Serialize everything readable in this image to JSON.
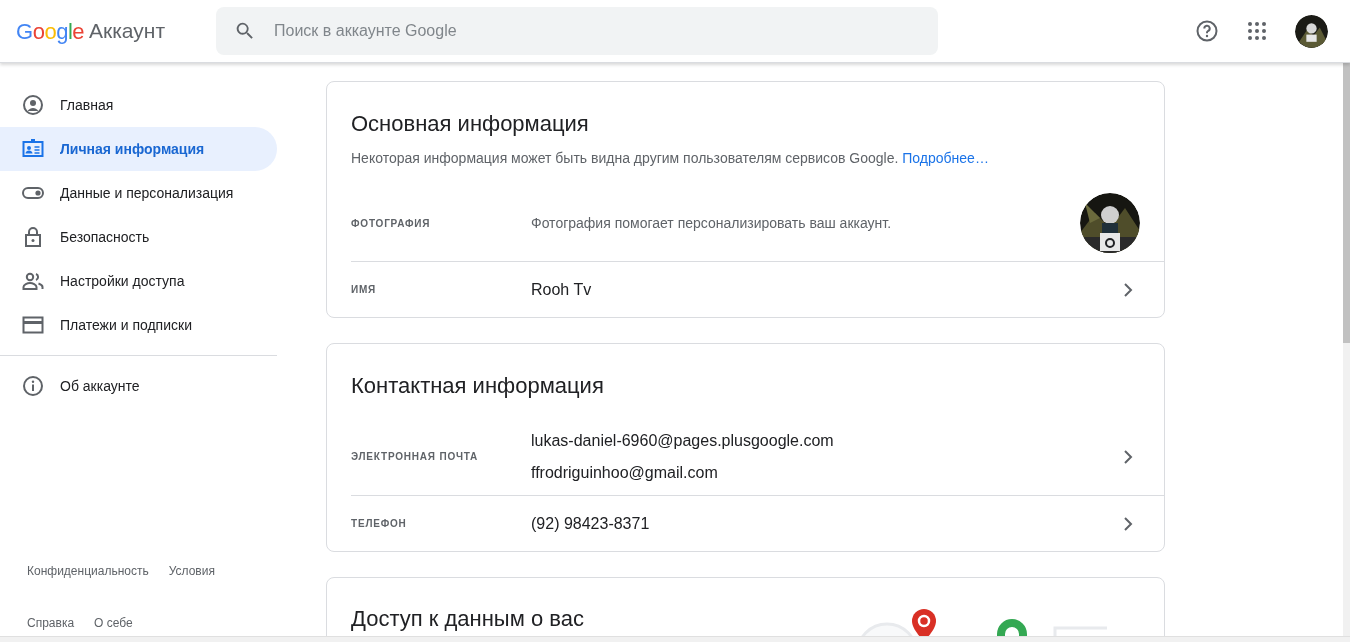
{
  "header": {
    "logo": "Google",
    "product": "Аккаунт",
    "search": {
      "placeholder": "Поиск в аккаунте Google"
    }
  },
  "sidebar": {
    "items": [
      {
        "label": "Главная",
        "kind": "home",
        "selected": false
      },
      {
        "label": "Личная информация",
        "kind": "person",
        "selected": true
      },
      {
        "label": "Данные и персонализация",
        "kind": "toggle",
        "selected": false
      },
      {
        "label": "Безопасность",
        "kind": "lock",
        "selected": false
      },
      {
        "label": "Настройки доступа",
        "kind": "people",
        "selected": false
      },
      {
        "label": "Платежи и подписки",
        "kind": "card",
        "selected": false
      }
    ],
    "secondary": [
      {
        "label": "Об аккаунте",
        "kind": "info",
        "selected": false
      }
    ],
    "footer_links": [
      [
        "Конфиденциальность",
        "Условия"
      ],
      [
        "Справка",
        "О себе"
      ]
    ]
  },
  "cards": [
    {
      "title": "Основная информация",
      "description": "Некоторая информация может быть видна другим пользователям сервисов Google.",
      "link": "Подробнее…",
      "rows": [
        {
          "label": "ФОТОГРАФИЯ",
          "values": [
            "Фотография помогает персонализировать ваш аккаунт."
          ]
        },
        {
          "kind": "text",
          "label": "ИМЯ",
          "values": [
            "Rooh Tv"
          ]
        }
      ]
    },
    {
      "title": "Контактная информация",
      "rows": [
        {
          "kind": "text",
          "label": "ЭЛЕКТРОННАЯ ПОЧТА",
          "values": [
            "lukas-daniel-6960@pages.plusgoogle.com",
            "ffrodriguinhoo@gmail.com"
          ]
        },
        {
          "kind": "text",
          "label": "ТЕЛЕФОН",
          "values": [
            "(92) 98423-8371"
          ]
        }
      ]
    },
    {
      "title": "Доступ к данным о вас",
      "kind": "illustrated"
    }
  ]
}
